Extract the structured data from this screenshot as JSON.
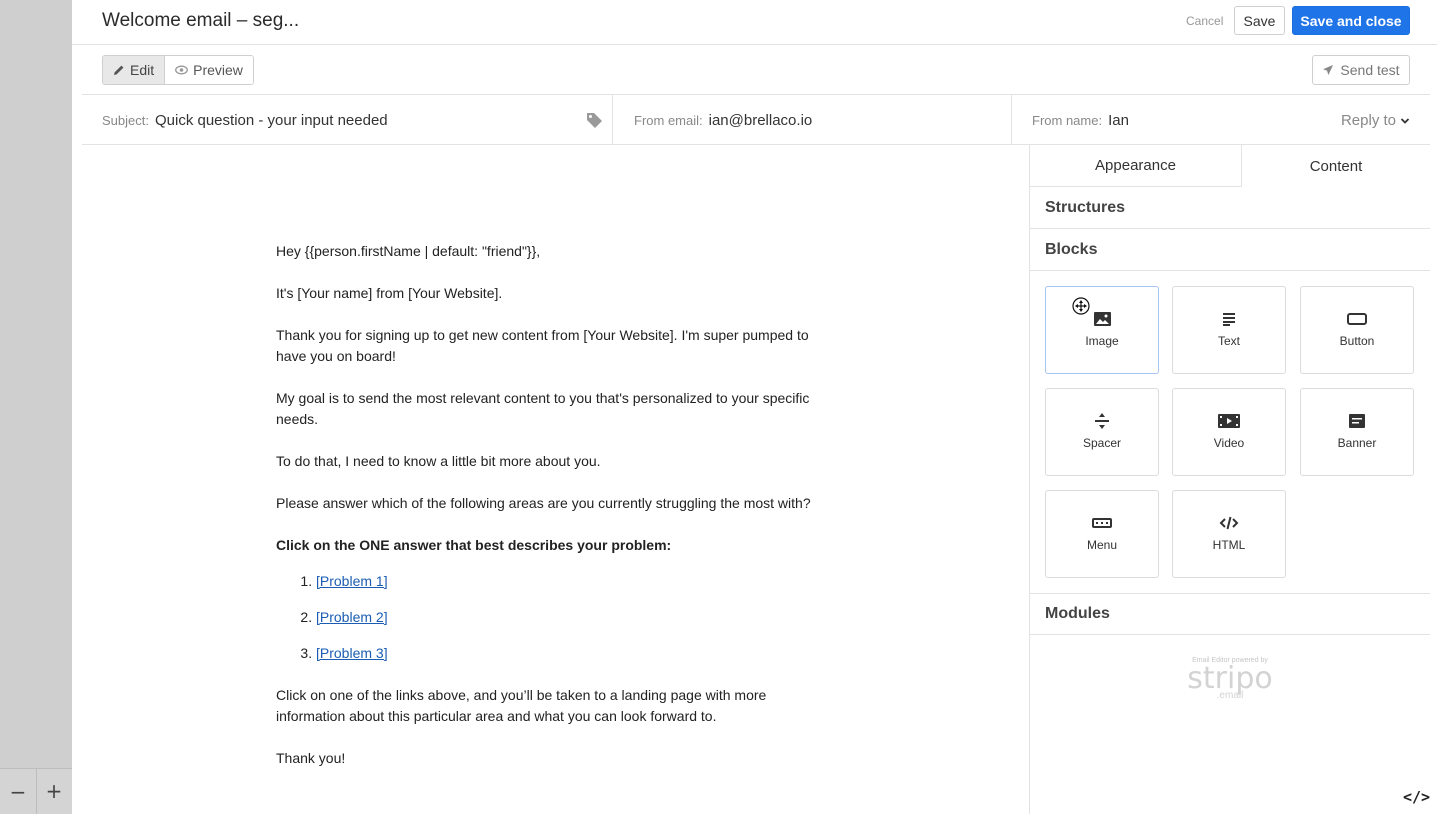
{
  "zoom": {
    "minus": "−",
    "plus": "+"
  },
  "header": {
    "title": "Welcome email – seg...",
    "cancel": "Cancel",
    "save": "Save",
    "save_close": "Save and close"
  },
  "toolbar": {
    "edit": "Edit",
    "preview": "Preview",
    "send_test": "Send test"
  },
  "fields": {
    "subject_label": "Subject:",
    "subject_value": "Quick question - your input needed",
    "from_email_label": "From email:",
    "from_email_value": "ian@brellaco.io",
    "from_name_label": "From name:",
    "from_name_value": "Ian",
    "reply_to": "Reply to"
  },
  "email": {
    "greeting": "Hey {{person.firstName | default: \"friend\"}},",
    "p1": "It's [Your name] from [Your Website].",
    "p2": "Thank you for signing up to get new content from [Your Website]. I'm super pumped to have you on board!",
    "p3": "My goal is to send the most relevant content to you that's personalized to your specific needs.",
    "p4": "To do that, I need to know a little bit more about you.",
    "p5": "Please answer which of the following areas are you currently struggling the most with?",
    "p6": "Click on the ONE answer that best describes your problem:",
    "links": [
      "[Problem 1]",
      "[Problem 2]",
      "[Problem 3]"
    ],
    "p7": "Click on one of the links above, and you’ll be taken to a landing page with more information about this particular area and what you can look forward to.",
    "p8": "Thank you!"
  },
  "panel": {
    "tabs": [
      "Appearance",
      "Content"
    ],
    "sections": {
      "structures": "Structures",
      "blocks": "Blocks",
      "modules": "Modules"
    },
    "blocks": [
      "Image",
      "Text",
      "Button",
      "Spacer",
      "Video",
      "Banner",
      "Menu",
      "HTML"
    ],
    "branding": {
      "small": "Email Editor powered by",
      "name": "stripo",
      "suffix": ".email"
    }
  },
  "colors": {
    "primary": "#1f74e8",
    "link": "#1a5db3",
    "selected_border": "#a8c4f0"
  }
}
